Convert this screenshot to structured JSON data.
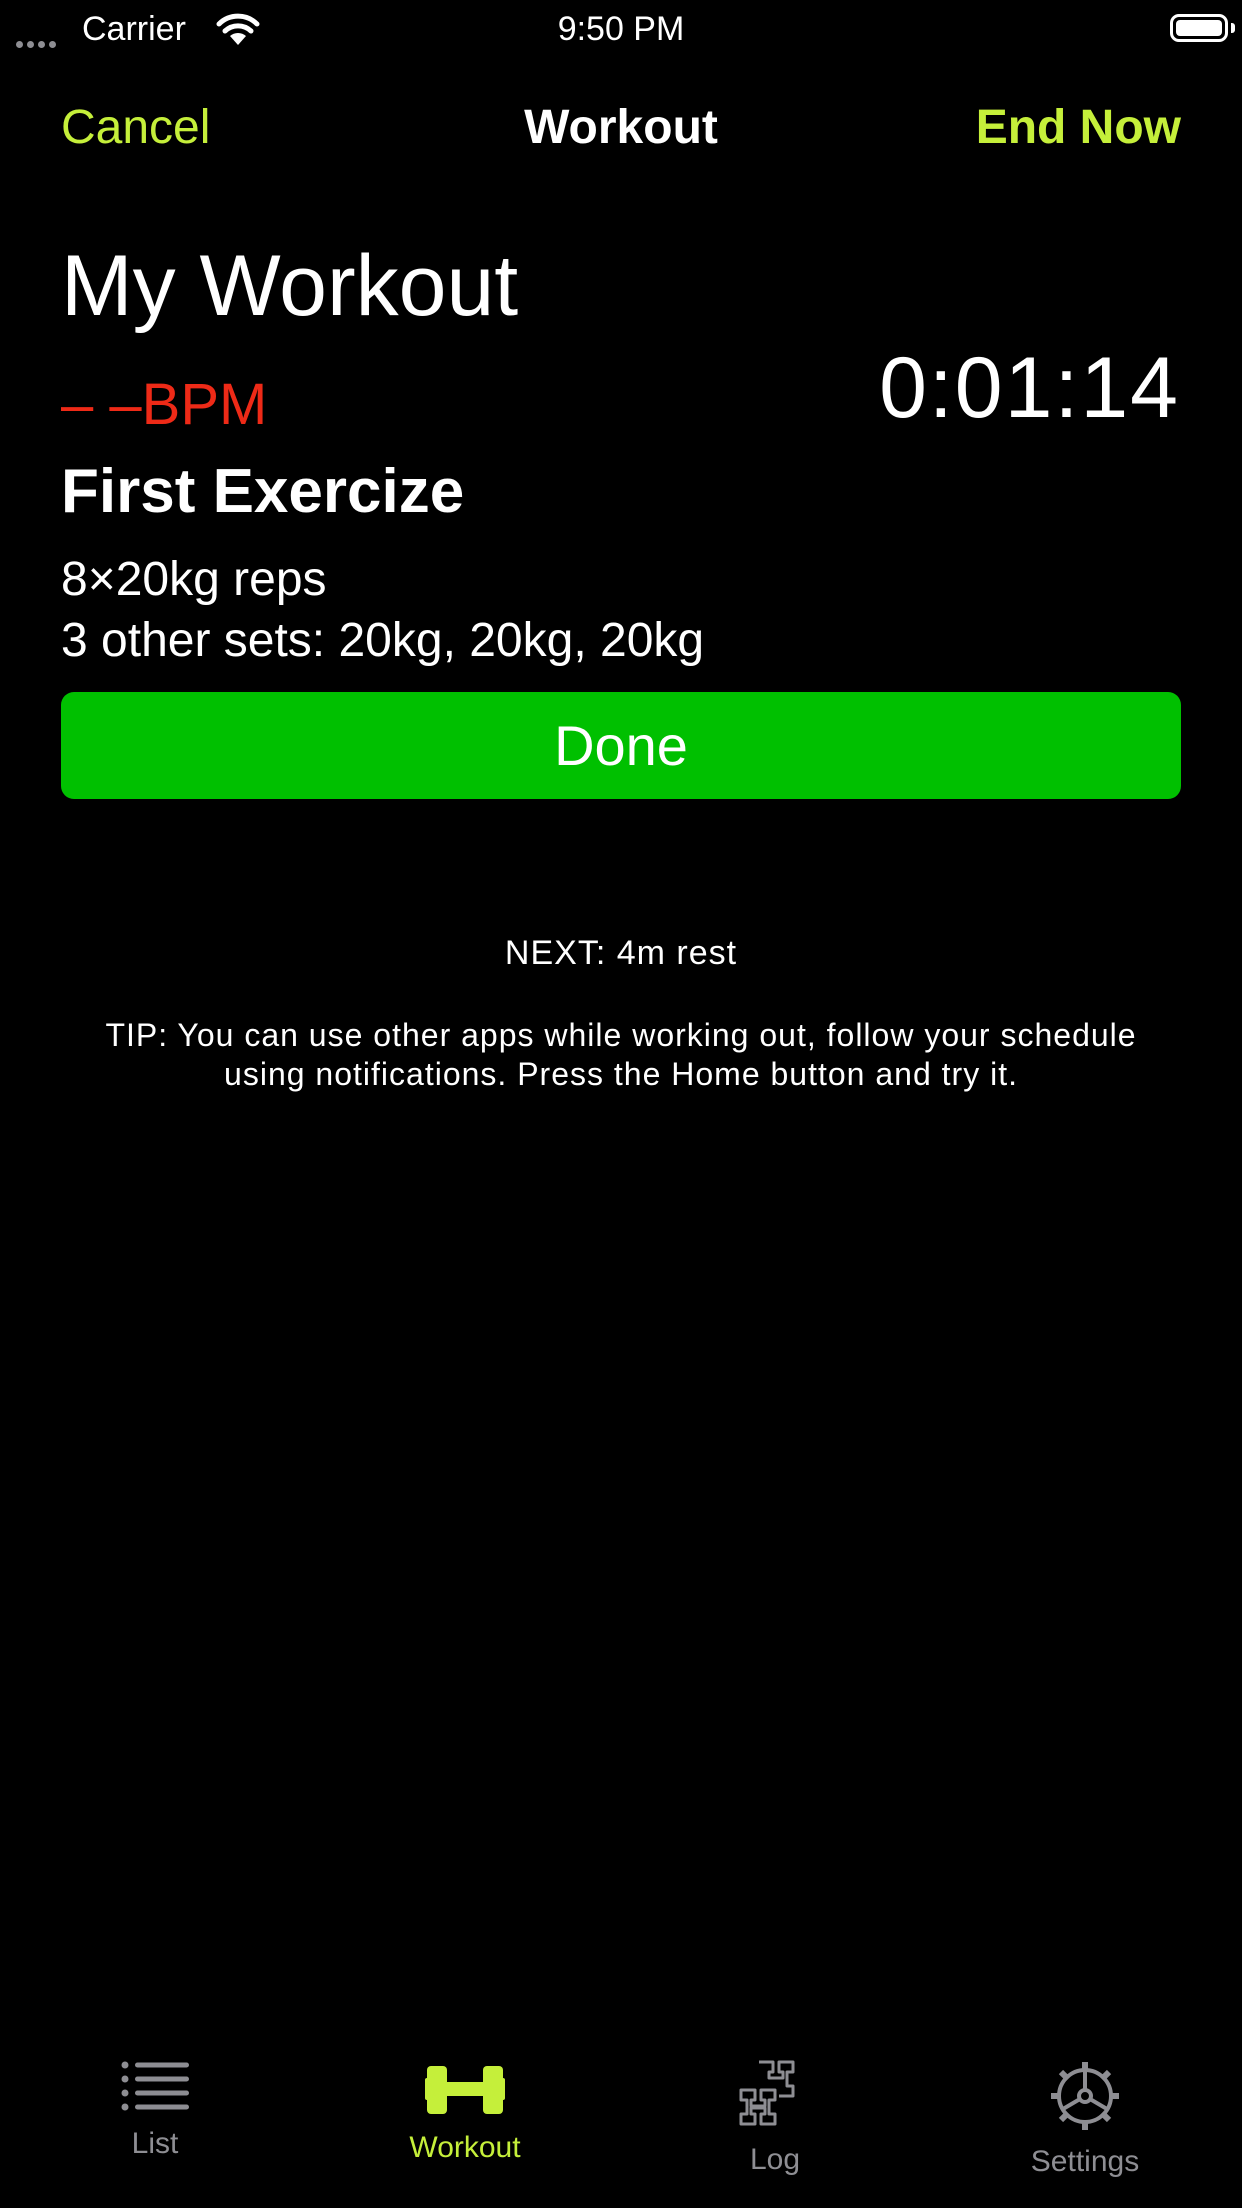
{
  "status_bar": {
    "carrier": "Carrier",
    "time": "9:50 PM"
  },
  "nav": {
    "cancel": "Cancel",
    "title": "Workout",
    "end_now": "End Now"
  },
  "workout": {
    "name": "My Workout",
    "bpm": "– –BPM",
    "timer": "0:01:14",
    "exercise": "First Exercize",
    "reps": "8×20kg reps",
    "other_sets": "3 other sets: 20kg, 20kg, 20kg",
    "done_label": "Done",
    "next": "NEXT: 4m rest",
    "tip": "TIP: You can use other apps while working out, follow your schedule using notifications. Press the Home button and try it."
  },
  "tabs": [
    {
      "label": "List",
      "icon": "list-icon",
      "active": false
    },
    {
      "label": "Workout",
      "icon": "dumbbell-icon",
      "active": true
    },
    {
      "label": "Log",
      "icon": "log-icon",
      "active": false
    },
    {
      "label": "Settings",
      "icon": "gear-icon",
      "active": false
    }
  ],
  "colors": {
    "accent": "#c5ef3a",
    "done_button": "#00c000",
    "bpm": "#ee2a17",
    "inactive_tab": "#8e8e93",
    "background": "#000000"
  }
}
